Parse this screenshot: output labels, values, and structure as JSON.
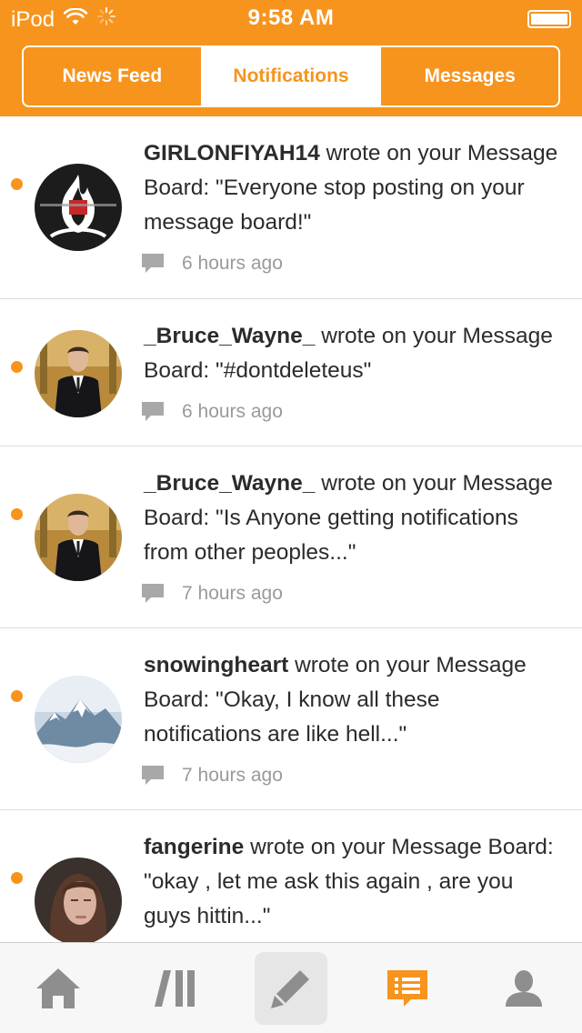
{
  "status": {
    "carrier": "iPod",
    "time": "9:58 AM"
  },
  "segments": [
    {
      "label": "News Feed",
      "active": false
    },
    {
      "label": "Notifications",
      "active": true
    },
    {
      "label": "Messages",
      "active": false
    }
  ],
  "notifications": [
    {
      "user": "GIRLONFIYAH14",
      "text": " wrote on your Message Board: \"Everyone stop posting on your message board!\"",
      "time": "6 hours ago",
      "avatar": "fire-logo",
      "unread": true
    },
    {
      "user": "_Bruce_Wayne_",
      "text": " wrote on your Message Board: \"#dontdeleteus\"",
      "time": "6 hours ago",
      "avatar": "man-in-suit",
      "unread": true
    },
    {
      "user": "_Bruce_Wayne_",
      "text": " wrote on your Message Board: \"Is Anyone getting notifications from other peoples...\"",
      "time": "7 hours ago",
      "avatar": "man-in-suit",
      "unread": true
    },
    {
      "user": "snowingheart",
      "text": " wrote on your Message Board: \"Okay, I know all these notifications are like hell...\"",
      "time": "7 hours ago",
      "avatar": "snowy-mountain",
      "unread": true
    },
    {
      "user": "fangerine",
      "text": " wrote on your Message Board: \"okay , let me ask this again , are you guys hittin...\"",
      "time": "",
      "avatar": "woman-portrait",
      "unread": true
    }
  ],
  "tabbar": {
    "items": [
      "home-icon",
      "feed-icon",
      "compose-icon",
      "notifications-icon",
      "profile-icon"
    ],
    "active": "notifications-icon"
  },
  "colors": {
    "accent": "#f7941d",
    "inactive_icon": "#8e8e8e",
    "meta_text": "#9a9a9a"
  }
}
